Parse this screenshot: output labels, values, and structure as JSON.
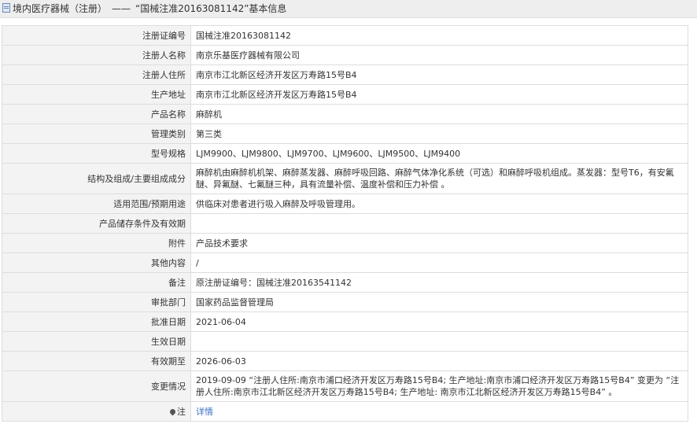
{
  "header": {
    "category": "境内医疗器械（注册）",
    "separator": "——",
    "title": "“国械注准20163081142”基本信息"
  },
  "rows": [
    {
      "label": "注册证编号",
      "value": "国械注准20163081142"
    },
    {
      "label": "注册人名称",
      "value": "南京乐基医疗器械有限公司"
    },
    {
      "label": "注册人住所",
      "value": "南京市江北新区经济开发区万寿路15号B4"
    },
    {
      "label": "生产地址",
      "value": "南京市江北新区经济开发区万寿路15号B4"
    },
    {
      "label": "产品名称",
      "value": "麻醉机"
    },
    {
      "label": "管理类别",
      "value": "第三类"
    },
    {
      "label": "型号规格",
      "value": "LJM9900、LJM9800、LJM9700、LJM9600、LJM9500、LJM9400"
    },
    {
      "label": "结构及组成/主要组成成分",
      "value": "麻醉机由麻醉机机架、麻醉蒸发器、麻醉呼吸回路、麻醉气体净化系统（可选）和麻醉呼吸机组成。蒸发器：型号T6，有安氟醚、异氟醚、七氟醚三种，具有流量补偿、温度补偿和压力补偿 。"
    },
    {
      "label": "适用范围/预期用途",
      "value": "供临床对患者进行吸入麻醉及呼吸管理用。"
    },
    {
      "label": "产品储存条件及有效期",
      "value": ""
    },
    {
      "label": "附件",
      "value": "产品技术要求"
    },
    {
      "label": "其他内容",
      "value": "/"
    },
    {
      "label": "备注",
      "value": "原注册证编号：国械注准20163541142"
    },
    {
      "label": "审批部门",
      "value": "国家药品监督管理局"
    },
    {
      "label": "批准日期",
      "value": "2021-06-04"
    },
    {
      "label": "生效日期",
      "value": ""
    },
    {
      "label": "有效期至",
      "value": "2026-06-03"
    },
    {
      "label": "变更情况",
      "value": "2019-09-09 “注册人住所:南京市浦口经济开发区万寿路15号B4; 生产地址:南京市浦口经济开发区万寿路15号B4” 变更为 “注册人住所:南京市江北新区经济开发区万寿路15号B4; 生产地址: 南京市江北新区经济开发区万寿路15号B4” 。"
    }
  ],
  "note": {
    "label": "注",
    "icon": "location-pin-icon",
    "link_text": "详情"
  },
  "colors": {
    "header_bg": "#eeeeee",
    "label_bg": "#f3f3f3",
    "border": "#dddddd",
    "link": "#3a6fc4"
  }
}
